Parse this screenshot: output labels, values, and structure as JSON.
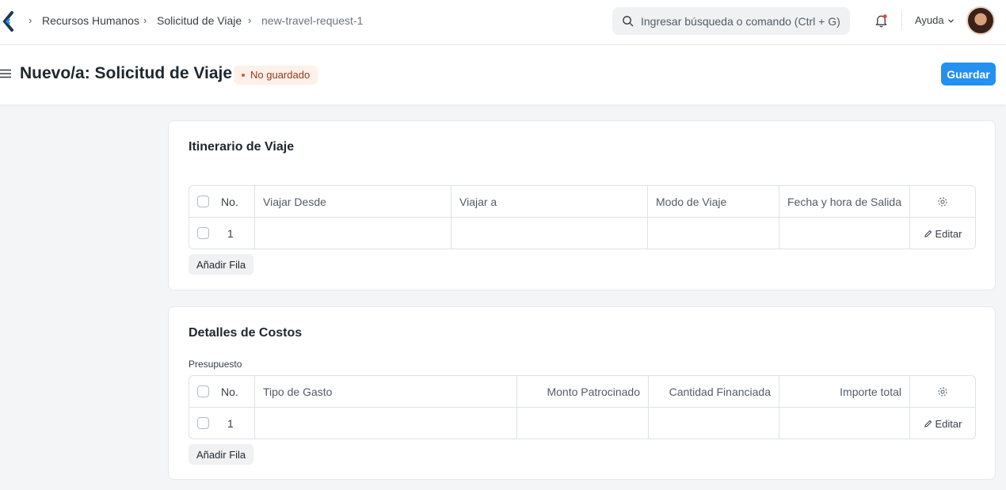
{
  "navbar": {
    "breadcrumbs": [
      "Recursos Humanos",
      "Solicitud de Viaje",
      "new-travel-request-1"
    ],
    "search_placeholder": "Ingresar búsqueda o comando (Ctrl + G)",
    "help_label": "Ayuda"
  },
  "header": {
    "title": "Nuevo/a: Solicitud de Viaje",
    "status": "No guardado",
    "save_label": "Guardar"
  },
  "itinerary": {
    "title": "Itinerario de Viaje",
    "columns": [
      "No.",
      "Viajar Desde",
      "Viajar a",
      "Modo de Viaje",
      "Fecha y hora de Salida"
    ],
    "rows": [
      {
        "no": "1",
        "edit_label": "Editar"
      }
    ],
    "add_row_label": "Añadir Fila"
  },
  "costs": {
    "title": "Detalles de Costos",
    "field_label": "Presupuesto",
    "columns": [
      "No.",
      "Tipo de Gasto",
      "Monto Patrocinado",
      "Cantidad Financiada",
      "Importe total"
    ],
    "rows": [
      {
        "no": "1",
        "edit_label": "Editar"
      }
    ],
    "add_row_label": "Añadir Fila"
  },
  "colors": {
    "primary": "#2490ef",
    "status_text": "#8d3b1c",
    "status_bg": "#fff0ea",
    "page_bg": "#f4f5f6"
  },
  "icons": [
    "app-logo",
    "breadcrumb-chevron-icon",
    "search-icon",
    "bell-icon",
    "chevron-down-icon",
    "menu-icon",
    "settings-icon",
    "edit-icon"
  ]
}
